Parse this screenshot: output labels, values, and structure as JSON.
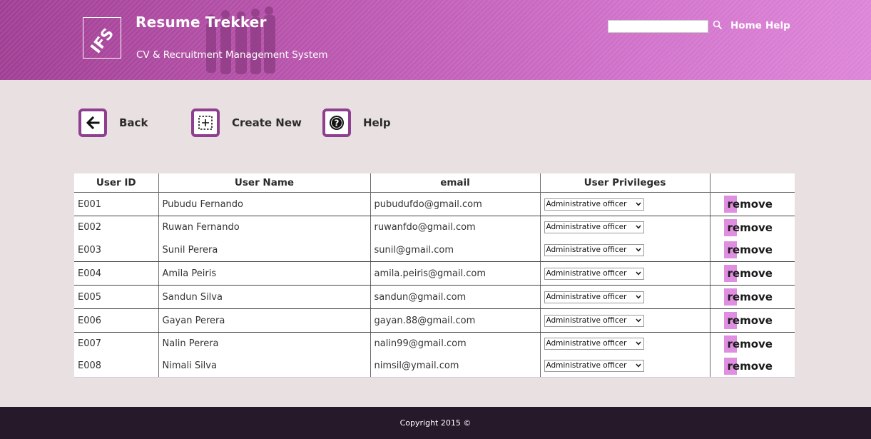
{
  "header": {
    "logo_text": "IFS",
    "title": "Resume Trekker",
    "subtitle": "CV & Recruitment Management System",
    "search": {
      "placeholder": "",
      "value": ""
    },
    "nav": {
      "home": "Home",
      "help": "Help"
    },
    "colors": {
      "accent": "#8f3f8f",
      "gradient_start": "#a13f94",
      "gradient_end": "#dd86d8"
    }
  },
  "toolbar": {
    "back_label": "Back",
    "create_label": "Create New",
    "help_label": "Help"
  },
  "table": {
    "columns": [
      "User ID",
      "User Name",
      "email",
      "User Privileges",
      ""
    ],
    "remove_label": "remove",
    "rows": [
      {
        "id": "E001",
        "name": "Pubudu Fernando",
        "email": "pubudufdo@gmail.com",
        "privilege": "Administrative officer"
      },
      {
        "id": "E002",
        "name": "Ruwan Fernando",
        "email": "ruwanfdo@gmail.com",
        "privilege": "Administrative officer"
      },
      {
        "id": "E003",
        "name": "Sunil Perera",
        "email": "sunil@gmail.com",
        "privilege": "Administrative officer"
      },
      {
        "id": "E004",
        "name": "Amila Peiris",
        "email": "amila.peiris@gmail.com",
        "privilege": "Administrative officer"
      },
      {
        "id": "E005",
        "name": "Sandun Silva",
        "email": "sandun@gmail.com",
        "privilege": "Administrative officer"
      },
      {
        "id": "E006",
        "name": "Gayan Perera",
        "email": "gayan.88@gmail.com",
        "privilege": "Administrative officer"
      },
      {
        "id": "E007",
        "name": "Nalin Perera",
        "email": "nalin99@gmail.com",
        "privilege": "Administrative officer"
      },
      {
        "id": "E008",
        "name": "Nimali Silva",
        "email": "nimsil@ymail.com",
        "privilege": "Administrative officer"
      }
    ]
  },
  "footer": {
    "copyright": "Copyright 2015 ©"
  }
}
